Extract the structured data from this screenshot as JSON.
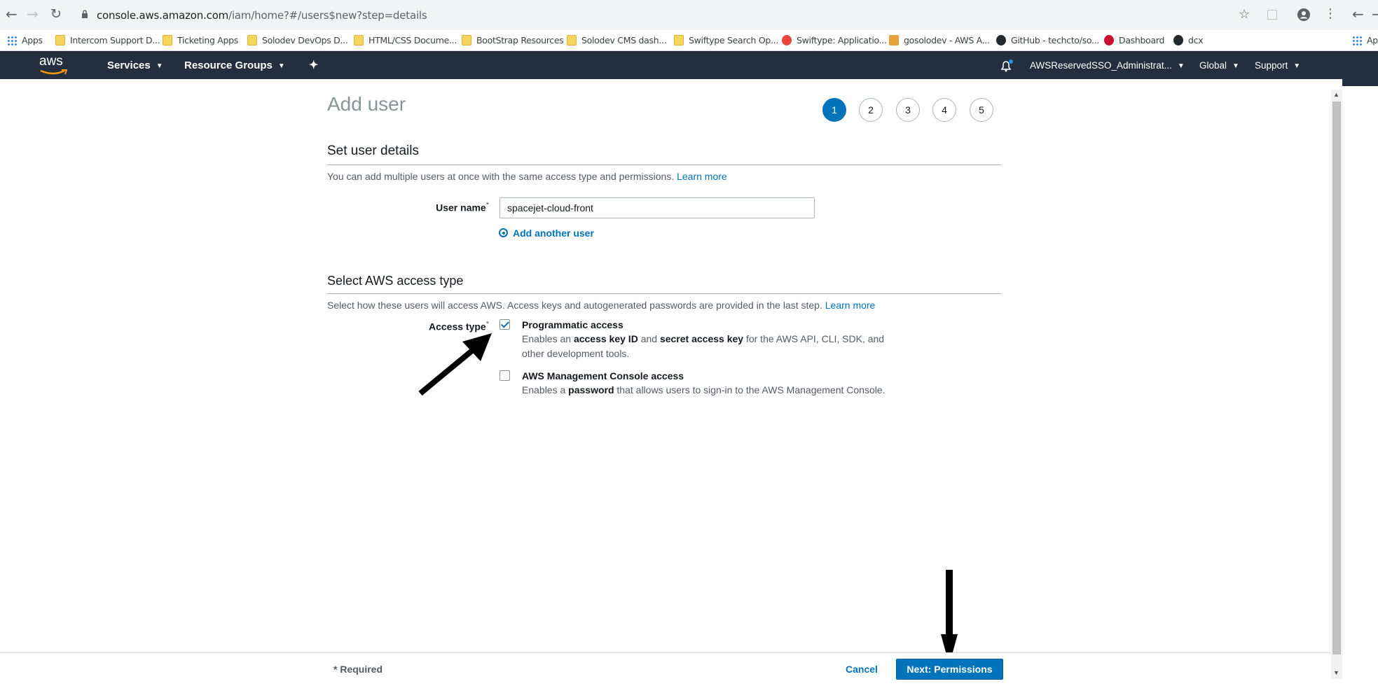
{
  "browser": {
    "url_host": "console.aws.amazon.com",
    "url_path": "/iam/home?#/users$new?step=details",
    "back_icon": "back-arrow-icon",
    "forward_icon": "forward-arrow-icon",
    "reload_icon": "reload-icon",
    "bookmarks": [
      {
        "label": "Apps",
        "icon": "apps-grid-icon"
      },
      {
        "label": "Intercom Support D...",
        "icon": "folder-icon"
      },
      {
        "label": "Ticketing Apps",
        "icon": "folder-icon"
      },
      {
        "label": "Solodev DevOps D...",
        "icon": "folder-icon"
      },
      {
        "label": "HTML/CSS Docume...",
        "icon": "folder-icon"
      },
      {
        "label": "BootStrap Resources",
        "icon": "folder-icon"
      },
      {
        "label": "Solodev CMS dash...",
        "icon": "folder-icon"
      },
      {
        "label": "Swiftype Search Op...",
        "icon": "folder-icon"
      },
      {
        "label": "Swiftype: Applicatio...",
        "icon": "swiftype-icon"
      },
      {
        "label": "gosolodev - AWS A...",
        "icon": "aws-box-icon"
      },
      {
        "label": "GitHub - techcto/so...",
        "icon": "github-icon"
      },
      {
        "label": "Dashboard",
        "icon": "gear-red-icon"
      },
      {
        "label": "dcx",
        "icon": "github-icon"
      },
      {
        "label": "Ap",
        "icon": "apps-grid-icon"
      }
    ]
  },
  "aws_nav": {
    "logo": "aws",
    "services": "Services",
    "resource_groups": "Resource Groups",
    "account": "AWSReservedSSO_Administrat...",
    "region": "Global",
    "support": "Support"
  },
  "page": {
    "title": "Add user",
    "steps": [
      "1",
      "2",
      "3",
      "4",
      "5"
    ],
    "active_step": "1"
  },
  "details": {
    "heading": "Set user details",
    "description": "You can add multiple users at once with the same access type and permissions.",
    "learn_more": "Learn more",
    "username_label": "User name",
    "required_mark": "*",
    "username_value": "spacejet-cloud-front",
    "add_another": "Add another user"
  },
  "access": {
    "heading": "Select AWS access type",
    "description": "Select how these users will access AWS. Access keys and autogenerated passwords are provided in the last step.",
    "learn_more": "Learn more",
    "label": "Access type",
    "programmatic": {
      "title": "Programmatic access",
      "desc_1": "Enables an ",
      "desc_bold_1": "access key ID",
      "desc_2": " and ",
      "desc_bold_2": "secret access key",
      "desc_3": " for the AWS API, CLI, SDK, and other development tools.",
      "checked": true
    },
    "console": {
      "title": "AWS Management Console access",
      "desc_1": "Enables a ",
      "desc_bold_1": "password",
      "desc_2": " that allows users to sign-in to the AWS Management Console.",
      "checked": false
    }
  },
  "footer": {
    "required_note": "* Required",
    "cancel": "Cancel",
    "next": "Next: Permissions"
  }
}
